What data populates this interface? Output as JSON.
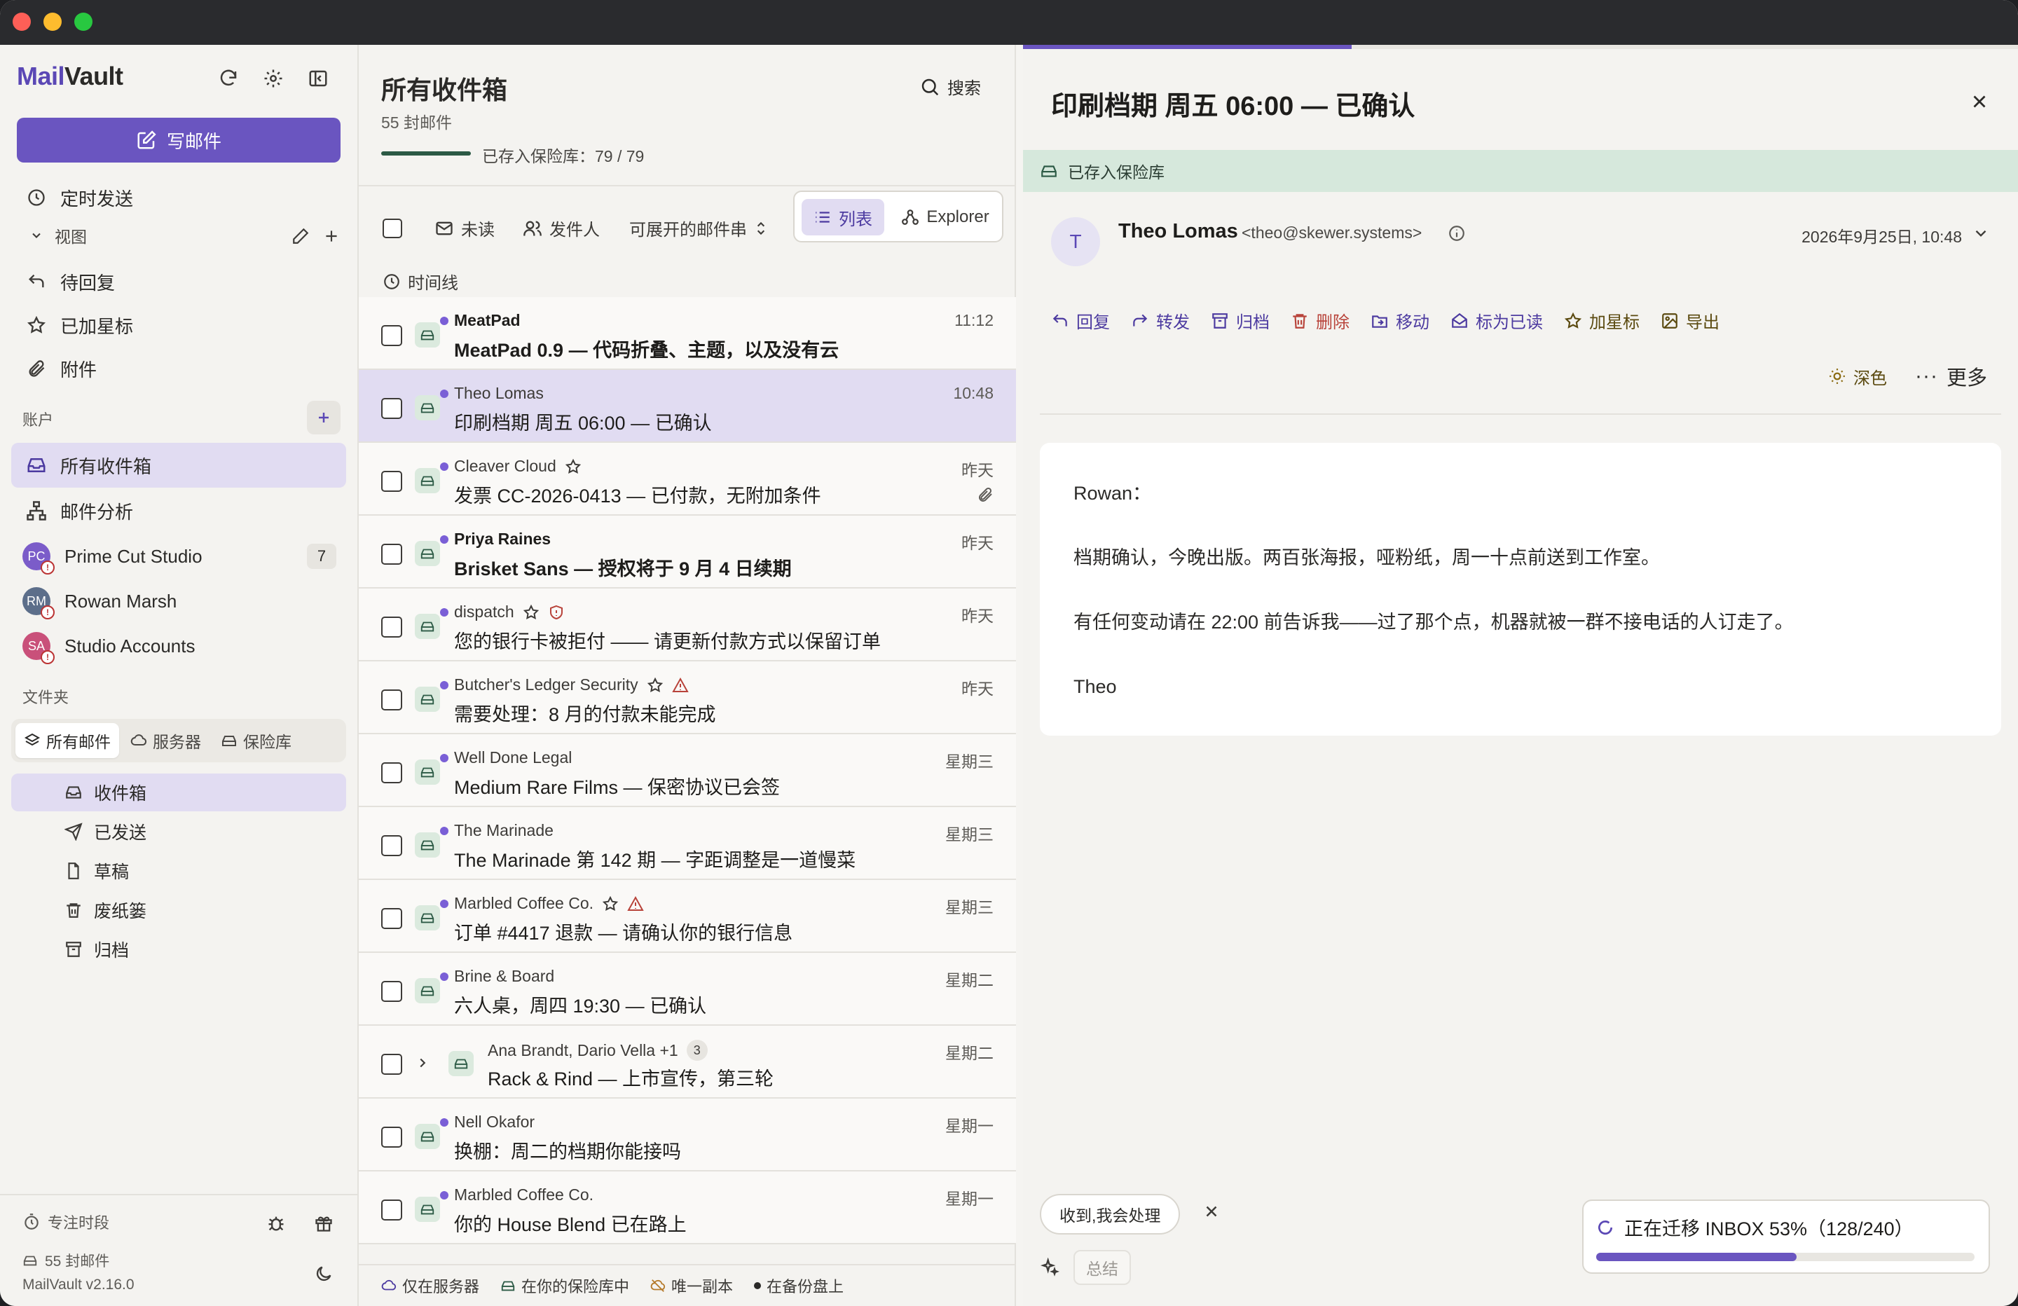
{
  "app": {
    "name_prefix": "Mail",
    "name_suffix": "Vault",
    "version": "MailVault v2.16.0"
  },
  "sidebar": {
    "compose_label": "写邮件",
    "scheduled": "定时发送",
    "views_label": "视图",
    "views": [
      {
        "label": "待回复",
        "icon": "reply-icon"
      },
      {
        "label": "已加星标",
        "icon": "star-icon"
      },
      {
        "label": "附件",
        "icon": "paperclip-icon"
      }
    ],
    "accounts_label": "账户",
    "all_inboxes": "所有收件箱",
    "analytics": "邮件分析",
    "accounts": [
      {
        "label": "Prime Cut Studio",
        "initials": "PC",
        "color": "#7b5cc9",
        "badge": "7"
      },
      {
        "label": "Rowan Marsh",
        "initials": "RM",
        "color": "#5c6e8a",
        "badge": ""
      },
      {
        "label": "Studio Accounts",
        "initials": "SA",
        "color": "#c9507a",
        "badge": ""
      }
    ],
    "folders_label": "文件夹",
    "folder_tabs": [
      "所有邮件",
      "服务器",
      "保险库"
    ],
    "folders": [
      {
        "label": "收件箱",
        "icon": "inbox-icon"
      },
      {
        "label": "已发送",
        "icon": "send-icon"
      },
      {
        "label": "草稿",
        "icon": "draft-icon"
      },
      {
        "label": "废纸篓",
        "icon": "trash-icon"
      },
      {
        "label": "归档",
        "icon": "archive-icon"
      }
    ],
    "focus": "专注时段",
    "mail_count": "55 封邮件"
  },
  "list": {
    "title": "所有收件箱",
    "subtitle": "55 封邮件",
    "search": "搜索",
    "vault_status": "已存入保险库：79 / 79",
    "filters": {
      "unread": "未读",
      "sender": "发件人",
      "expandable": "可展开的邮件串",
      "list": "列表",
      "explorer": "Explorer",
      "timeline": "时间线"
    },
    "rows": [
      {
        "sender": "MeatPad",
        "subject": "MeatPad 0.9 — 代码折叠、主题，以及没有云",
        "time": "11:12",
        "unread": true,
        "star": false,
        "warn": "",
        "attach": false,
        "thread": ""
      },
      {
        "sender": "Theo Lomas",
        "subject": "印刷档期 周五 06:00 — 已确认",
        "time": "10:48",
        "unread": false,
        "star": false,
        "warn": "",
        "attach": false,
        "thread": "",
        "selected": true
      },
      {
        "sender": "Cleaver Cloud",
        "subject": "发票 CC-2026-0413 — 已付款，无附加条件",
        "time": "昨天",
        "unread": false,
        "star": true,
        "warn": "",
        "attach": true,
        "thread": ""
      },
      {
        "sender": "Priya Raines",
        "subject": "Brisket Sans — 授权将于 9 月 4 日续期",
        "time": "昨天",
        "unread": true,
        "star": false,
        "warn": "",
        "attach": false,
        "thread": ""
      },
      {
        "sender": "dispatch",
        "subject": "您的银行卡被拒付 —— 请更新付款方式以保留订单",
        "time": "昨天",
        "unread": false,
        "star": true,
        "warn": "shield",
        "attach": false,
        "thread": ""
      },
      {
        "sender": "Butcher's Ledger Security",
        "subject": "需要处理：8 月的付款未能完成",
        "time": "昨天",
        "unread": false,
        "star": true,
        "warn": "triangle",
        "attach": false,
        "thread": ""
      },
      {
        "sender": "Well Done Legal",
        "subject": "Medium Rare Films — 保密协议已会签",
        "time": "星期三",
        "unread": false,
        "star": false,
        "warn": "",
        "attach": false,
        "thread": ""
      },
      {
        "sender": "The Marinade",
        "subject": "The Marinade 第 142 期 — 字距调整是一道慢菜",
        "time": "星期三",
        "unread": false,
        "star": false,
        "warn": "",
        "attach": false,
        "thread": ""
      },
      {
        "sender": "Marbled Coffee Co.",
        "subject": "订单 #4417 退款 — 请确认你的银行信息",
        "time": "星期三",
        "unread": false,
        "star": true,
        "warn": "triangle",
        "attach": false,
        "thread": ""
      },
      {
        "sender": "Brine & Board",
        "subject": "六人桌，周四 19:30 — 已确认",
        "time": "星期二",
        "unread": false,
        "star": false,
        "warn": "",
        "attach": false,
        "thread": ""
      },
      {
        "sender": "Ana Brandt, Dario Vella +1",
        "subject": "Rack & Rind — 上市宣传，第三轮",
        "time": "星期二",
        "unread": false,
        "star": false,
        "warn": "",
        "attach": false,
        "thread": "3"
      },
      {
        "sender": "Nell Okafor",
        "subject": "换棚：周二的档期你能接吗",
        "time": "星期一",
        "unread": false,
        "star": false,
        "warn": "",
        "attach": false,
        "thread": ""
      },
      {
        "sender": "Marbled Coffee Co.",
        "subject": "你的 House Blend 已在路上",
        "time": "星期一",
        "unread": false,
        "star": false,
        "warn": "",
        "attach": false,
        "thread": ""
      }
    ],
    "legend": [
      "仅在服务器",
      "在你的保险库中",
      "唯一副本",
      "在备份盘上"
    ]
  },
  "reader": {
    "title": "印刷档期 周五 06:00 — 已确认",
    "vault_banner": "已存入保险库",
    "from_initial": "T",
    "from_name": "Theo Lomas",
    "from_addr": "<theo@skewer.systems>",
    "date": "2026年9月25日, 10:48",
    "actions": {
      "reply": "回复",
      "forward": "转发",
      "archive": "归档",
      "delete": "删除",
      "move": "移动",
      "mark_read": "标为已读",
      "star": "加星标",
      "export": "导出"
    },
    "theme": "深色",
    "more": "更多",
    "body": [
      "Rowan：",
      "档期确认，今晚出版。两百张海报，哑粉纸，周一十点前送到工作室。",
      "有任何变动请在 22:00 前告诉我——过了那个点，机器就被一群不接电话的人订走了。",
      "Theo"
    ],
    "quick_reply": "收到,我会处理",
    "summarize": "总结",
    "migration": {
      "text": "正在迁移 INBOX 53%（128/240）",
      "progress": 0.53
    },
    "top_progress": 0.33
  },
  "colors": {
    "accent": "#6a55c0",
    "vault_green": "#d6e8dc",
    "danger": "#b8433a"
  }
}
